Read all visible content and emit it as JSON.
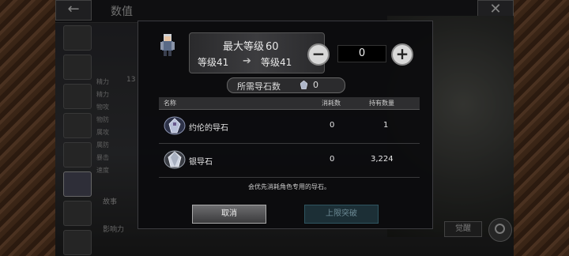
{
  "screen": {
    "title": "数值",
    "back_icon": "←",
    "close_icon": "✕",
    "side_stats": [
      "精力",
      "精力",
      "物攻",
      "物防",
      "属攻",
      "属防",
      "暴击",
      "速度"
    ],
    "hp_value": "13",
    "story_label": "故事",
    "influence_label": "影响力",
    "awaken_label": "觉醒"
  },
  "dialog": {
    "max_level_label": "最大等级",
    "max_level_value": "60",
    "current_level": "等级41",
    "arrow": "➔",
    "new_level": "等级41",
    "minus_label": "−",
    "plus_label": "+",
    "stepper_value": "0",
    "required_label": "所需导石数",
    "required_count": "0",
    "table": {
      "headers": [
        "名称",
        "消耗数",
        "持有数量"
      ],
      "rows": [
        {
          "name": "约伦的导石",
          "consume": "0",
          "owned": "1"
        },
        {
          "name": "银导石",
          "consume": "0",
          "owned": "3,224"
        }
      ]
    },
    "note": "会优先消耗角色专用的导石。",
    "cancel_label": "取消",
    "breakthrough_label": "上限突破"
  }
}
